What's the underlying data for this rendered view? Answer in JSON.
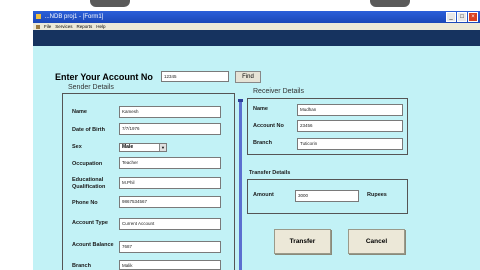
{
  "window": {
    "title": "...NDB proj1 - [Form1]",
    "menu": [
      "File",
      "Services",
      "Reports",
      "Help"
    ]
  },
  "form": {
    "account_prompt": "Enter Your Account No",
    "account_value": "12345",
    "find_label": "Find",
    "sender": {
      "title": "Sender Details",
      "fields": [
        {
          "label": "Name",
          "value": "Kamesh"
        },
        {
          "label": "Date of Birth",
          "value": "7/7/1976"
        },
        {
          "label": "Sex",
          "value": "Male"
        },
        {
          "label": "Occupation",
          "value": "Teacher"
        },
        {
          "label": "Educational Qualification",
          "value": "M.Phil"
        },
        {
          "label": "Phone No",
          "value": "9867534567"
        },
        {
          "label": "Account Type",
          "value": "Current Account"
        },
        {
          "label": "Acount Balance",
          "value": "7687"
        },
        {
          "label": "Branch",
          "value": "Malik"
        }
      ]
    },
    "receiver": {
      "title": "Receiver Details",
      "fields": [
        {
          "label": "Name",
          "value": "Mudhan"
        },
        {
          "label": "Account No",
          "value": "23456"
        },
        {
          "label": "Branch",
          "value": "Tuticorin"
        }
      ]
    },
    "transfer": {
      "title": "Transfer Details",
      "amount_label": "Amount",
      "amount_value": "3000",
      "currency_label": "Rupees"
    },
    "buttons": {
      "transfer": "Transfer",
      "cancel": "Cancel"
    }
  }
}
